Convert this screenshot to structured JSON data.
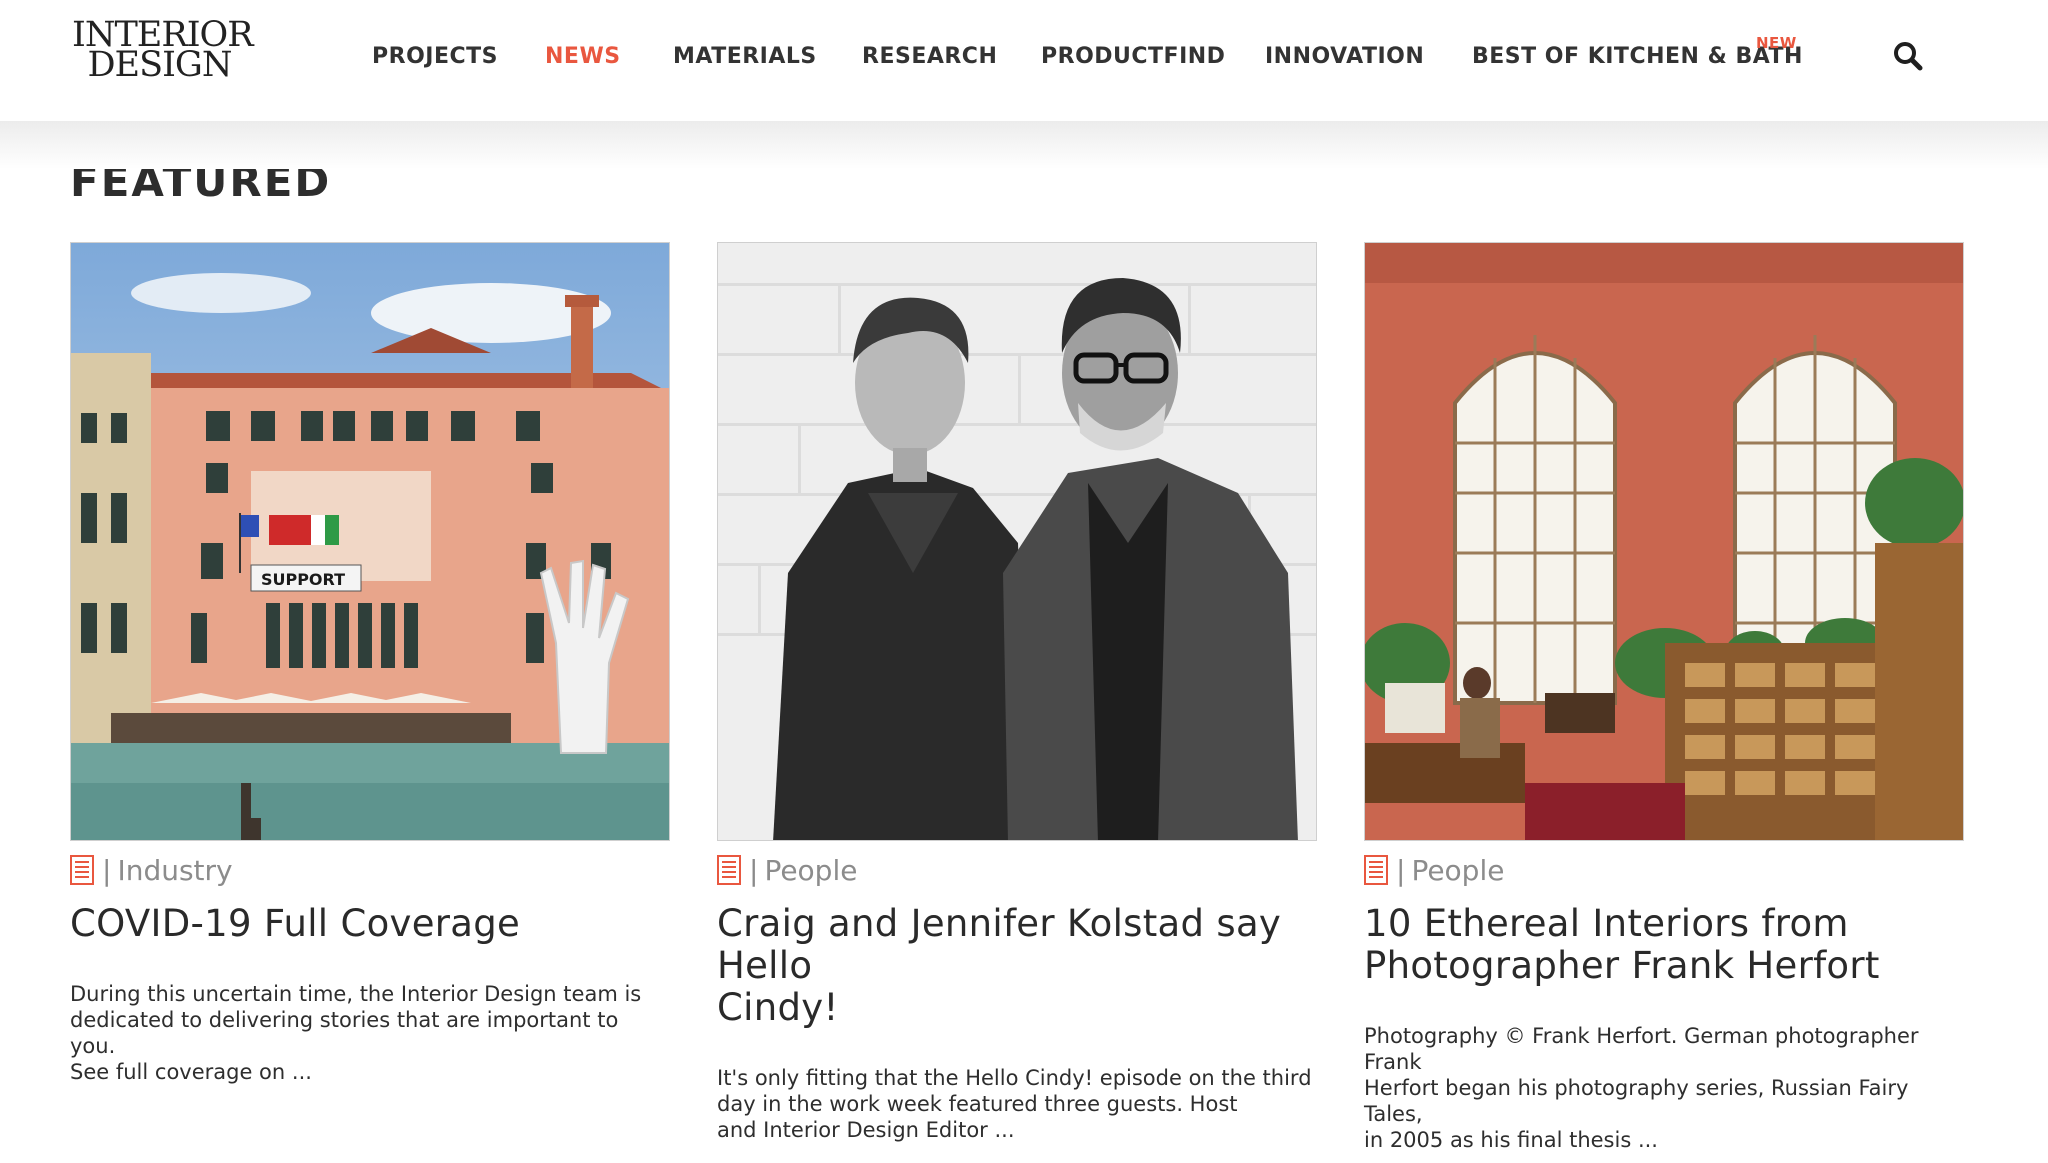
{
  "logo": {
    "line1": "INTERIOR",
    "line2": "DESIGN"
  },
  "nav": {
    "items": [
      {
        "label": "PROJECTS"
      },
      {
        "label": "NEWS"
      },
      {
        "label": "MATERIALS"
      },
      {
        "label": "RESEARCH"
      },
      {
        "label": "PRODUCTFIND"
      },
      {
        "label": "INNOVATION"
      },
      {
        "label": "BEST OF KITCHEN & BATH"
      }
    ],
    "badge": "NEW",
    "active": "NEWS",
    "search_icon": "search-icon"
  },
  "featured": {
    "title": "FEATURED",
    "cards": [
      {
        "category": "Industry",
        "title": "COVID-19 Full Coverage",
        "excerpt_lines": [
          "During this uncertain time, the Interior Design team is",
          "dedicated to delivering stories that are important to you.",
          "See full coverage on ..."
        ]
      },
      {
        "category": "People",
        "title_lines": [
          "Craig and Jennifer Kolstad say Hello",
          "Cindy!"
        ],
        "excerpt_lines": [
          "It's only fitting that the Hello Cindy! episode on the third",
          "day in the work week featured three guests. Host",
          "and Interior Design Editor ..."
        ]
      },
      {
        "category": "People",
        "title_lines": [
          "10 Ethereal Interiors from",
          "Photographer Frank Herfort"
        ],
        "excerpt_lines": [
          "Photography © Frank Herfort. German photographer Frank",
          "Herfort began his photography series, Russian Fairy Tales,",
          "in 2005 as his final thesis ..."
        ]
      }
    ],
    "photo_texts": {
      "banner": "SUPPORT"
    }
  },
  "colors": {
    "accent": "#e9573f",
    "text": "#2b2b2b",
    "muted": "#8c8c8c"
  }
}
